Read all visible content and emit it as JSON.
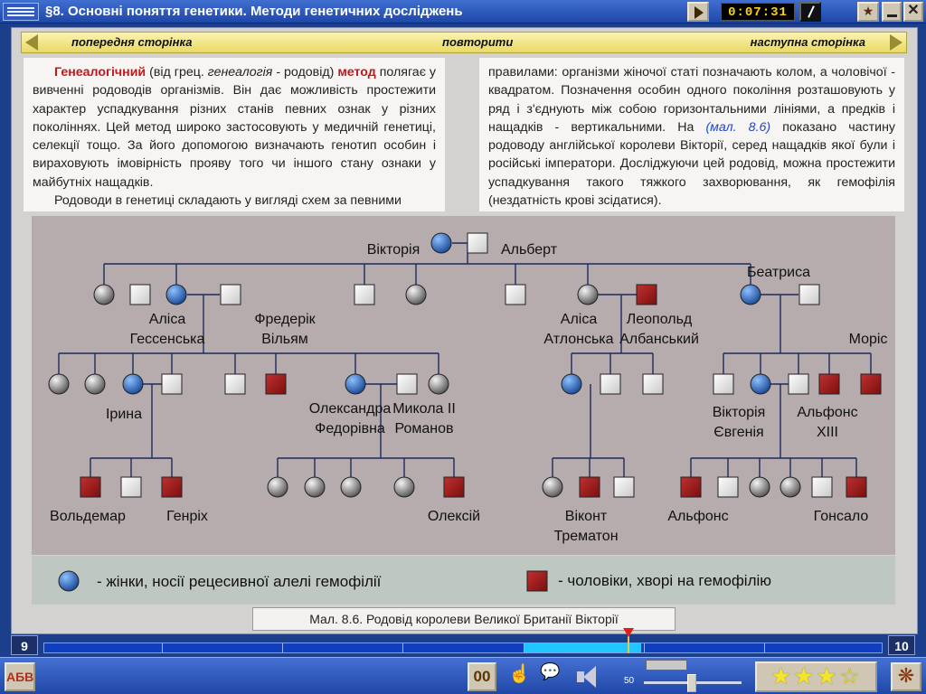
{
  "titlebar": {
    "title": "§8. Основні поняття генетики. Методи генетичних досліджень",
    "timer": "0:07:31"
  },
  "nav": {
    "prev": "попередня сторінка",
    "repeat": "повторити",
    "next": "наступна сторінка"
  },
  "text_left": {
    "p1_term": "Генеалогічний",
    "p1_a": " (від грец. ",
    "p1_greek": "генеалогія",
    "p1_b": " - родовід) ",
    "p1_method": "метод",
    "p1_c": " полягає у вивченні родоводів організмів. Він дає можливість простежити характер успадкування різних станів певних ознак у різних поколіннях. Цей метод широко застосовують у медичній генетиці, селекції тощо. За його допомогою визначають генотип особин і вираховують імовірність прояву того чи іншого стану ознаки у майбутніх нащадків.",
    "p2": "Родоводи в генетиці складають у вигляді схем за певними"
  },
  "text_right": {
    "a": "правилами: організми жіночої статі позначають колом, а чоловічої - квадратом. Позначення особин одного покоління розташовують у ряд і з'єднують між собою горизонтальними лініями, а предків і нащадків - вертикальними. На ",
    "ref": "(мал. 8.6)",
    "b": " показано частину родоводу англійської королеви Вікторії, серед нащадків якої були і російські імператори. Досліджуючи цей родовід, можна простежити успадкування такого тяжкого захворювання, як гемофілія (нездатність крові зсідатися)."
  },
  "legend": {
    "carrier": "-  жінки, носії рецесивної алелі гемофілії",
    "affected": "-  чоловіки, хворі на гемофілію"
  },
  "caption": "Мал. 8.6. Родовід королеви Великої Британії Вікторії",
  "progress": {
    "current_page": "9",
    "next_page": "10"
  },
  "bottom": {
    "abc": "АБВ",
    "counter": "00",
    "volume": "50",
    "stars": "★★★☆"
  },
  "colors": {
    "carrier": "#3f78c0",
    "affected": "#a01c1c",
    "female": "#7d7d7d",
    "male": "#e8e8e8"
  },
  "pedigree": {
    "names": {
      "victoria": "Вікторія",
      "albert": "Альберт",
      "alice_hesse": [
        "Аліса",
        "Гессенська"
      ],
      "frederick": [
        "Фредерік",
        "Вільям"
      ],
      "beatrice": "Беатриса",
      "alice_athlone": [
        "Аліса",
        "Атлонська"
      ],
      "leopold": [
        "Леопольд",
        "Албанський"
      ],
      "maurice": "Моріс",
      "irene": "Ірина",
      "alexandra": [
        "Олександра",
        "Федорівна"
      ],
      "nicholas": [
        "Микола II",
        "Романов"
      ],
      "victoria_eugenie": [
        "Вікторія",
        "Євгенія"
      ],
      "alfonso13": [
        "Альфонс",
        "XIII"
      ],
      "waldemar": "Вольдемар",
      "henry": "Генріх",
      "alexei": "Олексій",
      "trematon": [
        "Віконт",
        "Трематон"
      ],
      "alfonso": "Альфонс",
      "gonzalo": "Гонсало"
    }
  }
}
